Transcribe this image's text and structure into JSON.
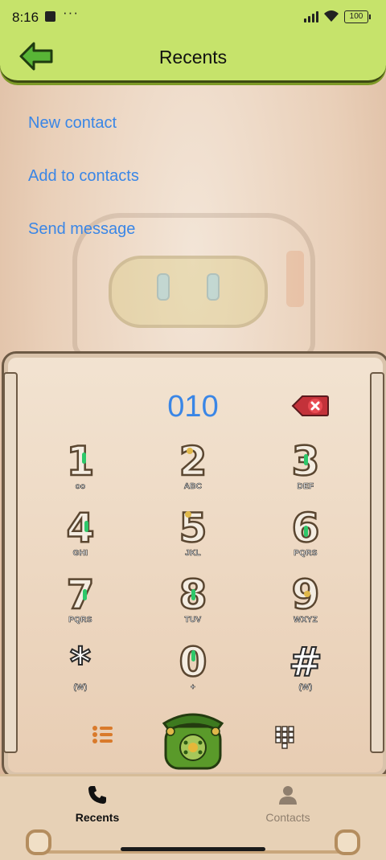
{
  "status": {
    "time": "8:16",
    "battery": "100"
  },
  "header": {
    "title": "Recents"
  },
  "menu": [
    {
      "label": "New contact"
    },
    {
      "label": "Add to contacts"
    },
    {
      "label": "Send message"
    }
  ],
  "dialer": {
    "number": "010",
    "keys": [
      {
        "digit": "1",
        "sub": "oo"
      },
      {
        "digit": "2",
        "sub": "ABC"
      },
      {
        "digit": "3",
        "sub": "DEF"
      },
      {
        "digit": "4",
        "sub": "GHI"
      },
      {
        "digit": "5",
        "sub": "JKL"
      },
      {
        "digit": "6",
        "sub": "PQRS"
      },
      {
        "digit": "7",
        "sub": "PQRS"
      },
      {
        "digit": "8",
        "sub": "TUV"
      },
      {
        "digit": "9",
        "sub": "WXYZ"
      },
      {
        "digit": "*",
        "sub": "(W)"
      },
      {
        "digit": "0",
        "sub": "+"
      },
      {
        "digit": "#",
        "sub": "(W)"
      }
    ]
  },
  "bottom_nav": {
    "recents": {
      "label": "Recents",
      "icon": "phone-icon"
    },
    "contacts": {
      "label": "Contacts",
      "icon": "person-icon"
    }
  },
  "colors": {
    "accent": "#3a86e6",
    "header": "#c6e36b",
    "nav_active": "#111111",
    "nav_inactive": "#8f7f6e"
  }
}
